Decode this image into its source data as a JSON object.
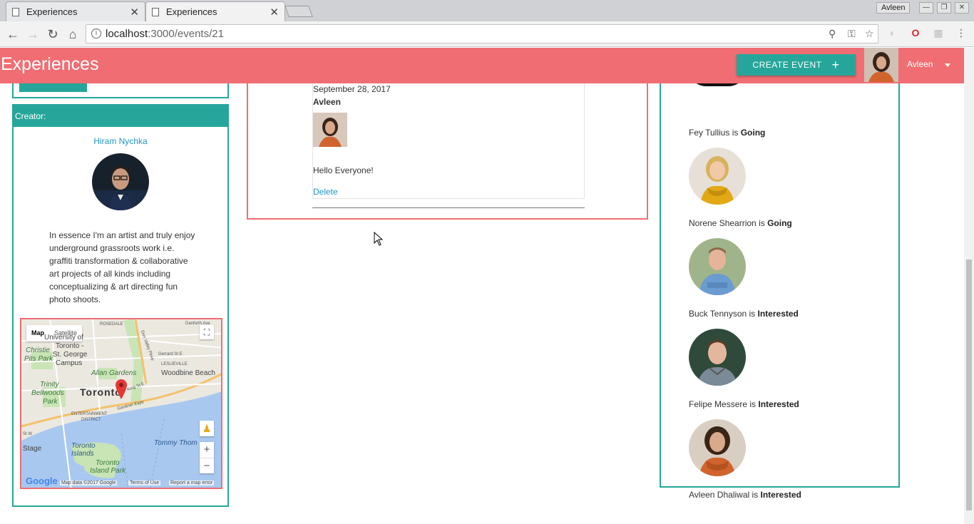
{
  "browser": {
    "tabs": [
      {
        "title": "Experiences",
        "active": false
      },
      {
        "title": "Experiences",
        "active": true
      }
    ],
    "profile_name": "Avleen",
    "url_host": "localhost",
    "url_path": ":3000/events/21"
  },
  "header": {
    "brand": "Experiences",
    "create_event_label": "CREATE EVENT",
    "create_event_icon": "+",
    "user_name": "Avleen"
  },
  "creator": {
    "heading": "Creator:",
    "name": "Hiram Nychka",
    "bio": "In essence I'm an artist and truly enjoy underground grassroots work i.e. graffiti transformation & collaborative art projects of all kinds including conceptualizing & art directing fun photo shoots."
  },
  "map": {
    "map_tab": "Map",
    "satellite_tab": "Satellite",
    "zoom_in": "+",
    "zoom_out": "−",
    "google": "Google",
    "map_data": "Map data ©2017 Google",
    "terms": "Terms of Use",
    "report": "Report a map error",
    "labels": {
      "rosedale": "ROSEDALE",
      "danforth": "Danforth Ave",
      "university": "University of",
      "toronto_st": "Toronto -",
      "st_george": "St. George",
      "campus": "Campus",
      "christie": "Christie",
      "pits_park": "Pits Park",
      "allan": "Allan Gardens",
      "gerrard": "Gerrard St E",
      "leslieville": "LESLIEVILLE",
      "woodbine": "Woodbine Beach",
      "trinity": "Trinity",
      "bellwoods": "Bellwoods",
      "park": "Park",
      "toronto": "Toronto",
      "king": "King St E",
      "gardiner": "Gardiner Expy",
      "entertainment": "ENTERTAINMENT",
      "district": "DISTRICT",
      "stw": "St W",
      "stage": "Stage",
      "toronto_islands": "Toronto",
      "islands": "Islands",
      "tommy": "Tommy Thom",
      "island_park": "Toronto",
      "island_park2": "Island Park",
      "dvp": "Don Valley Pkwy"
    }
  },
  "post": {
    "date": "September 28, 2017",
    "author": "Avleen",
    "text": "Hello Everyone!",
    "delete_label": "Delete"
  },
  "attendees": [
    {
      "name": "Fey Tullius",
      "connector": " is ",
      "status": "Going"
    },
    {
      "name": "Norene Shearrion",
      "connector": " is ",
      "status": "Going"
    },
    {
      "name": "Buck Tennyson",
      "connector": " is ",
      "status": "Interested"
    },
    {
      "name": "Felipe Messere",
      "connector": " is ",
      "status": "Interested"
    },
    {
      "name": "Avleen Dhaliwal",
      "connector": " is ",
      "status": "Interested"
    }
  ],
  "colors": {
    "brand": "#f06e73",
    "accent": "#26a69a",
    "link": "#2196c9"
  }
}
